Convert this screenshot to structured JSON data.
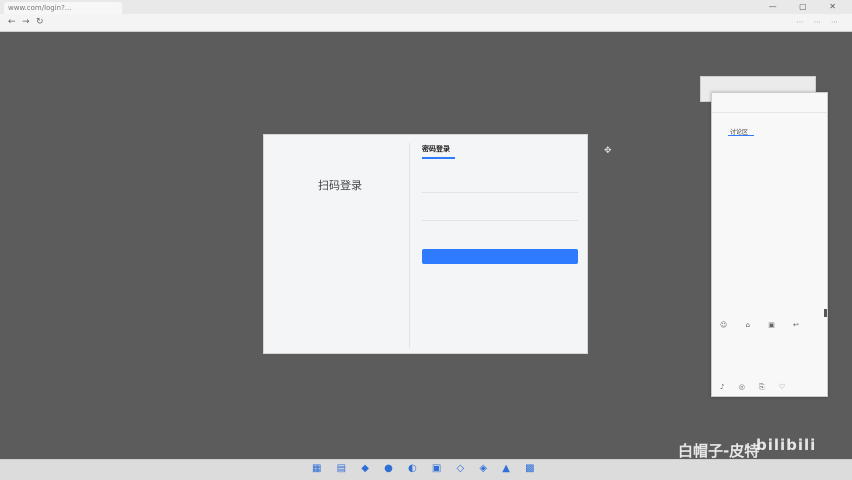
{
  "browser": {
    "tab_label": "www.com/login?...",
    "title": "",
    "url": "",
    "controls": "— ▢ ✕",
    "nav": {
      "back": "←",
      "forward": "→",
      "refresh": "↻"
    },
    "extensions": "⋯ ⋯ ⋯"
  },
  "login": {
    "qr_title": "扫码登录",
    "qr_note": "",
    "tab_password": "密码登录",
    "tab_sms": "",
    "username_placeholder": "",
    "password_placeholder": "",
    "forgot": "",
    "register": "",
    "button": "",
    "policy": "",
    "other_title": "",
    "other_icons": "",
    "app_left": "",
    "app_right": ""
  },
  "panel": {
    "back_title": "",
    "header": "",
    "tab": "讨论区",
    "sort": "",
    "comments": [
      {
        "who": "",
        "text": ""
      },
      {
        "who": "",
        "text": ""
      },
      {
        "who": "",
        "text": ""
      },
      {
        "who": "",
        "text": ""
      },
      {
        "who": "",
        "text": ""
      },
      {
        "who": "",
        "text": ""
      }
    ],
    "tools": "☺ ⌂ ▣ ↩",
    "footer": "♪ ◎ ⎘ ♡"
  },
  "taskbar": {
    "icons": "▦ ▤ ◆ ● ◐ ▣ ◇ ◈ ▲ ▩"
  },
  "watermark": {
    "text": "白帽子-皮特",
    "logo": "bilibili"
  },
  "colors": {
    "accent": "#2f7bff",
    "background": "#5c5c5c",
    "dialog": "#f4f5f7"
  }
}
